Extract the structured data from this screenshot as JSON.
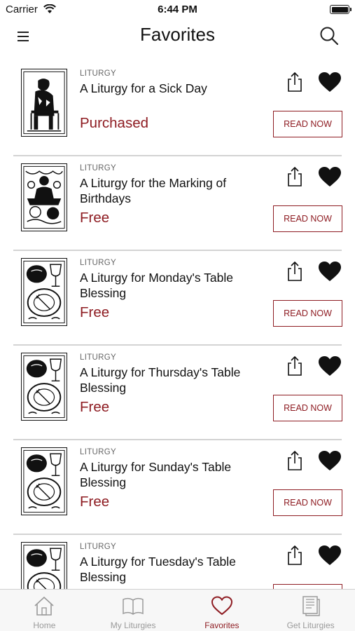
{
  "status": {
    "carrier": "Carrier",
    "time": "6:44 PM"
  },
  "nav": {
    "title": "Favorites",
    "menu_icon": "hamburger-menu-icon",
    "search_icon": "search-icon"
  },
  "colors": {
    "accent": "#8e1c22",
    "divider": "#d3d3d3",
    "tab_inactive": "#9a9a9a"
  },
  "items": [
    {
      "category": "LITURGY",
      "title": "A Liturgy for a Sick Day",
      "price": "Purchased",
      "button": "READ NOW",
      "art": "sick-man-illustration"
    },
    {
      "category": "LITURGY",
      "title": "A Liturgy for the Marking of Birthdays",
      "price": "Free",
      "button": "READ NOW",
      "art": "birthday-party-illustration"
    },
    {
      "category": "LITURGY",
      "title": "A Liturgy for Monday's Table Blessing",
      "price": "Free",
      "button": "READ NOW",
      "art": "table-blessing-illustration"
    },
    {
      "category": "LITURGY",
      "title": "A Liturgy for Thursday's Table Blessing",
      "price": "Free",
      "button": "READ NOW",
      "art": "table-blessing-illustration"
    },
    {
      "category": "LITURGY",
      "title": "A Liturgy for Sunday's Table Blessing",
      "price": "Free",
      "button": "READ NOW",
      "art": "table-blessing-illustration"
    },
    {
      "category": "LITURGY",
      "title": "A Liturgy for Tuesday's Table Blessing",
      "price": "",
      "button": "",
      "art": "table-blessing-illustration"
    }
  ],
  "tabs": [
    {
      "label": "Home",
      "icon": "home-icon",
      "active": false
    },
    {
      "label": "My Liturgies",
      "icon": "book-icon",
      "active": false
    },
    {
      "label": "Favorites",
      "icon": "heart-icon",
      "active": true
    },
    {
      "label": "Get Liturgies",
      "icon": "library-icon",
      "active": false
    }
  ]
}
